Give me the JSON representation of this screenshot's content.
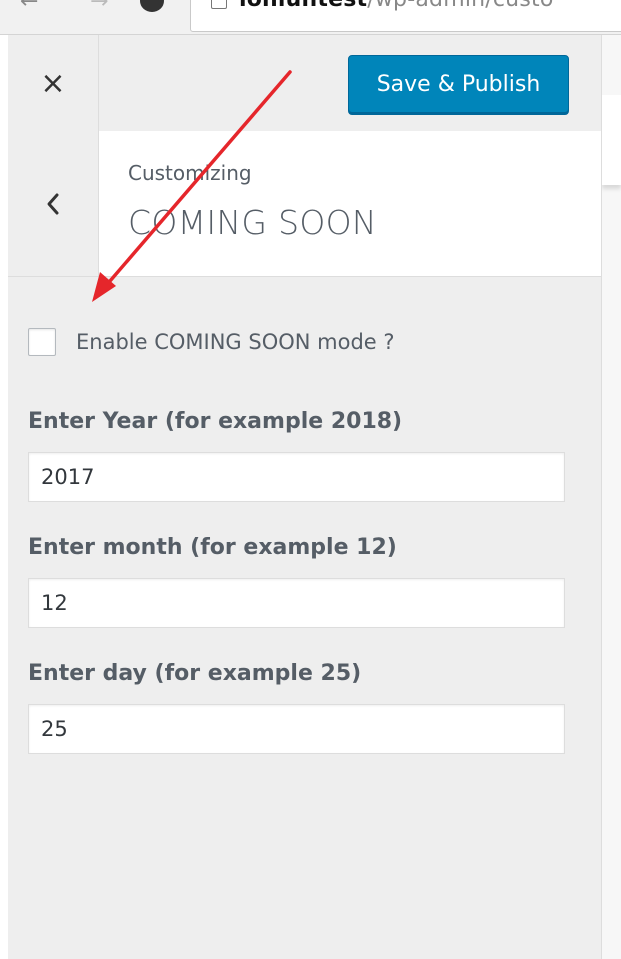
{
  "browser": {
    "url_domain": "ionluntest",
    "url_path": "/wp-admin/custo"
  },
  "header": {
    "close_label": "×",
    "save_label": "Save & Publish"
  },
  "section": {
    "back_label": "‹",
    "breadcrumb": "Customizing",
    "title": "COMING SOON"
  },
  "controls": {
    "enable_label": "Enable COMING SOON mode ?",
    "enable_checked": false,
    "year": {
      "label": "Enter Year (for example 2018)",
      "value": "2017"
    },
    "month": {
      "label": "Enter month (for example 12)",
      "value": "12"
    },
    "day": {
      "label": "Enter day (for example 25)",
      "value": "25"
    }
  },
  "colors": {
    "primary_button": "#0085ba",
    "sidebar_bg": "#eeeeee",
    "annotation_arrow": "#e5262b"
  },
  "icons": {
    "close": "close-icon",
    "back": "chevron-left-icon",
    "page": "page-icon"
  }
}
